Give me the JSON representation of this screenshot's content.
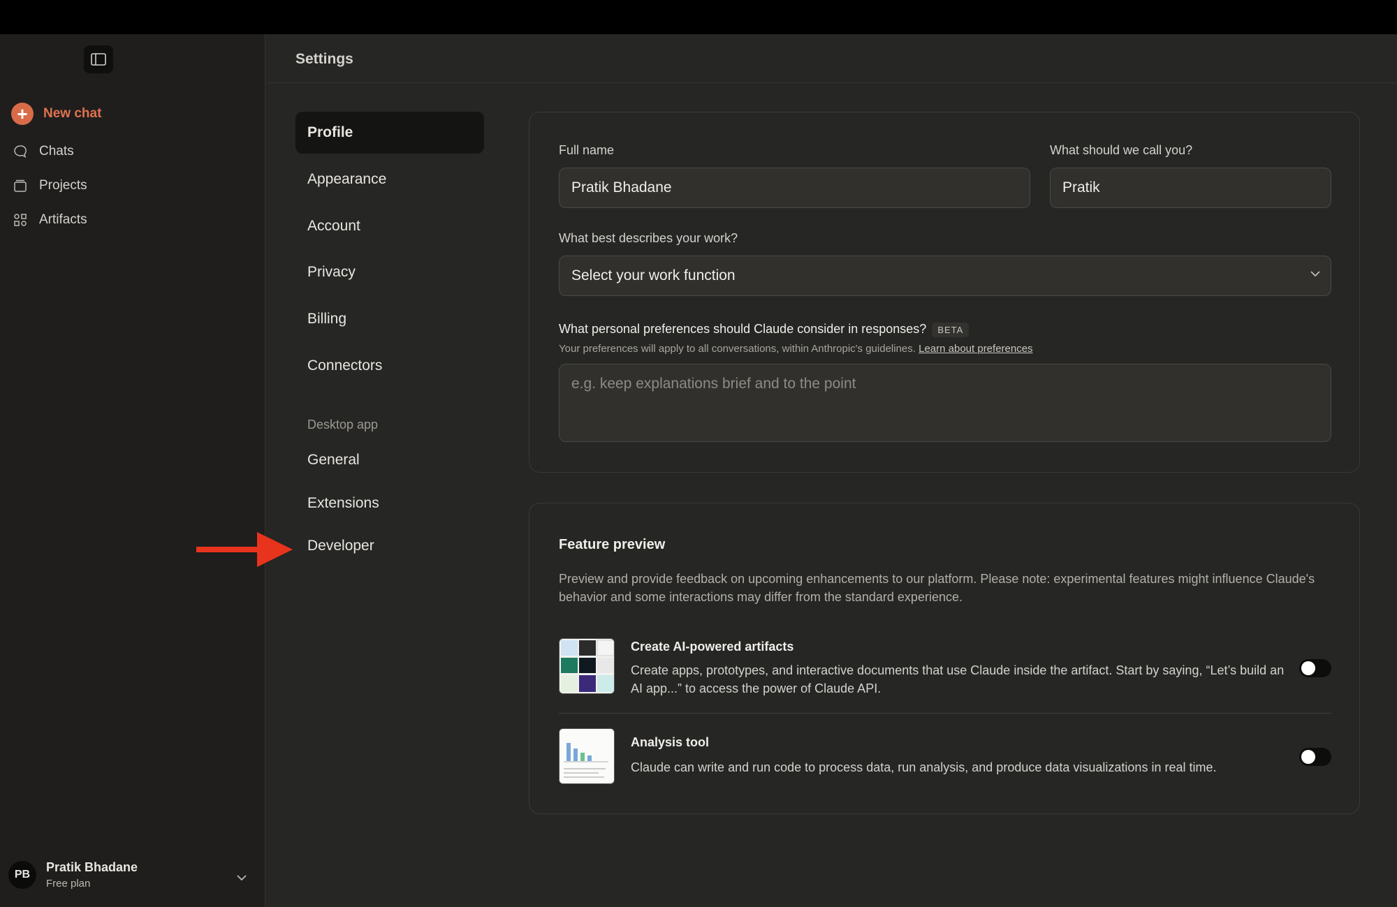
{
  "sidebar": {
    "new_chat": "New chat",
    "items": [
      {
        "label": "Chats",
        "icon": "chat-bubble-icon"
      },
      {
        "label": "Projects",
        "icon": "folder-icon"
      },
      {
        "label": "Artifacts",
        "icon": "artifacts-icon"
      }
    ],
    "user": {
      "initials": "PB",
      "name": "Pratik Bhadane",
      "plan": "Free plan"
    }
  },
  "header": {
    "title": "Settings"
  },
  "settings_nav": {
    "items": [
      "Profile",
      "Appearance",
      "Account",
      "Privacy",
      "Billing",
      "Connectors"
    ],
    "active": "Profile",
    "section_label": "Desktop app",
    "desktop_items": [
      "General",
      "Extensions",
      "Developer"
    ]
  },
  "profile": {
    "full_name_label": "Full name",
    "full_name_value": "Pratik Bhadane",
    "nickname_label": "What should we call you?",
    "nickname_value": "Pratik",
    "work_label": "What best describes your work?",
    "work_value": "Select your work function",
    "pref_label": "What personal preferences should Claude consider in responses?",
    "beta": "BETA",
    "pref_sub": "Your preferences will apply to all conversations, within Anthropic's guidelines.",
    "pref_link": "Learn about preferences",
    "pref_placeholder": "e.g. keep explanations brief and to the point"
  },
  "feature_preview": {
    "title": "Feature preview",
    "description": "Preview and provide feedback on upcoming enhancements to our platform. Please note: experimental features might influence Claude's behavior and some interactions may differ from the standard experience.",
    "features": [
      {
        "title": "Create AI-powered artifacts",
        "description": "Create apps, prototypes, and interactive documents that use Claude inside the artifact. Start by saying, “Let’s build an AI app...” to access the power of Claude API.",
        "enabled": false
      },
      {
        "title": "Analysis tool",
        "description": "Claude can write and run code to process data, run analysis, and produce data visualizations in real time.",
        "enabled": false
      }
    ]
  },
  "colors": {
    "accent": "#d96c48",
    "annotation_arrow": "#e8341c"
  }
}
